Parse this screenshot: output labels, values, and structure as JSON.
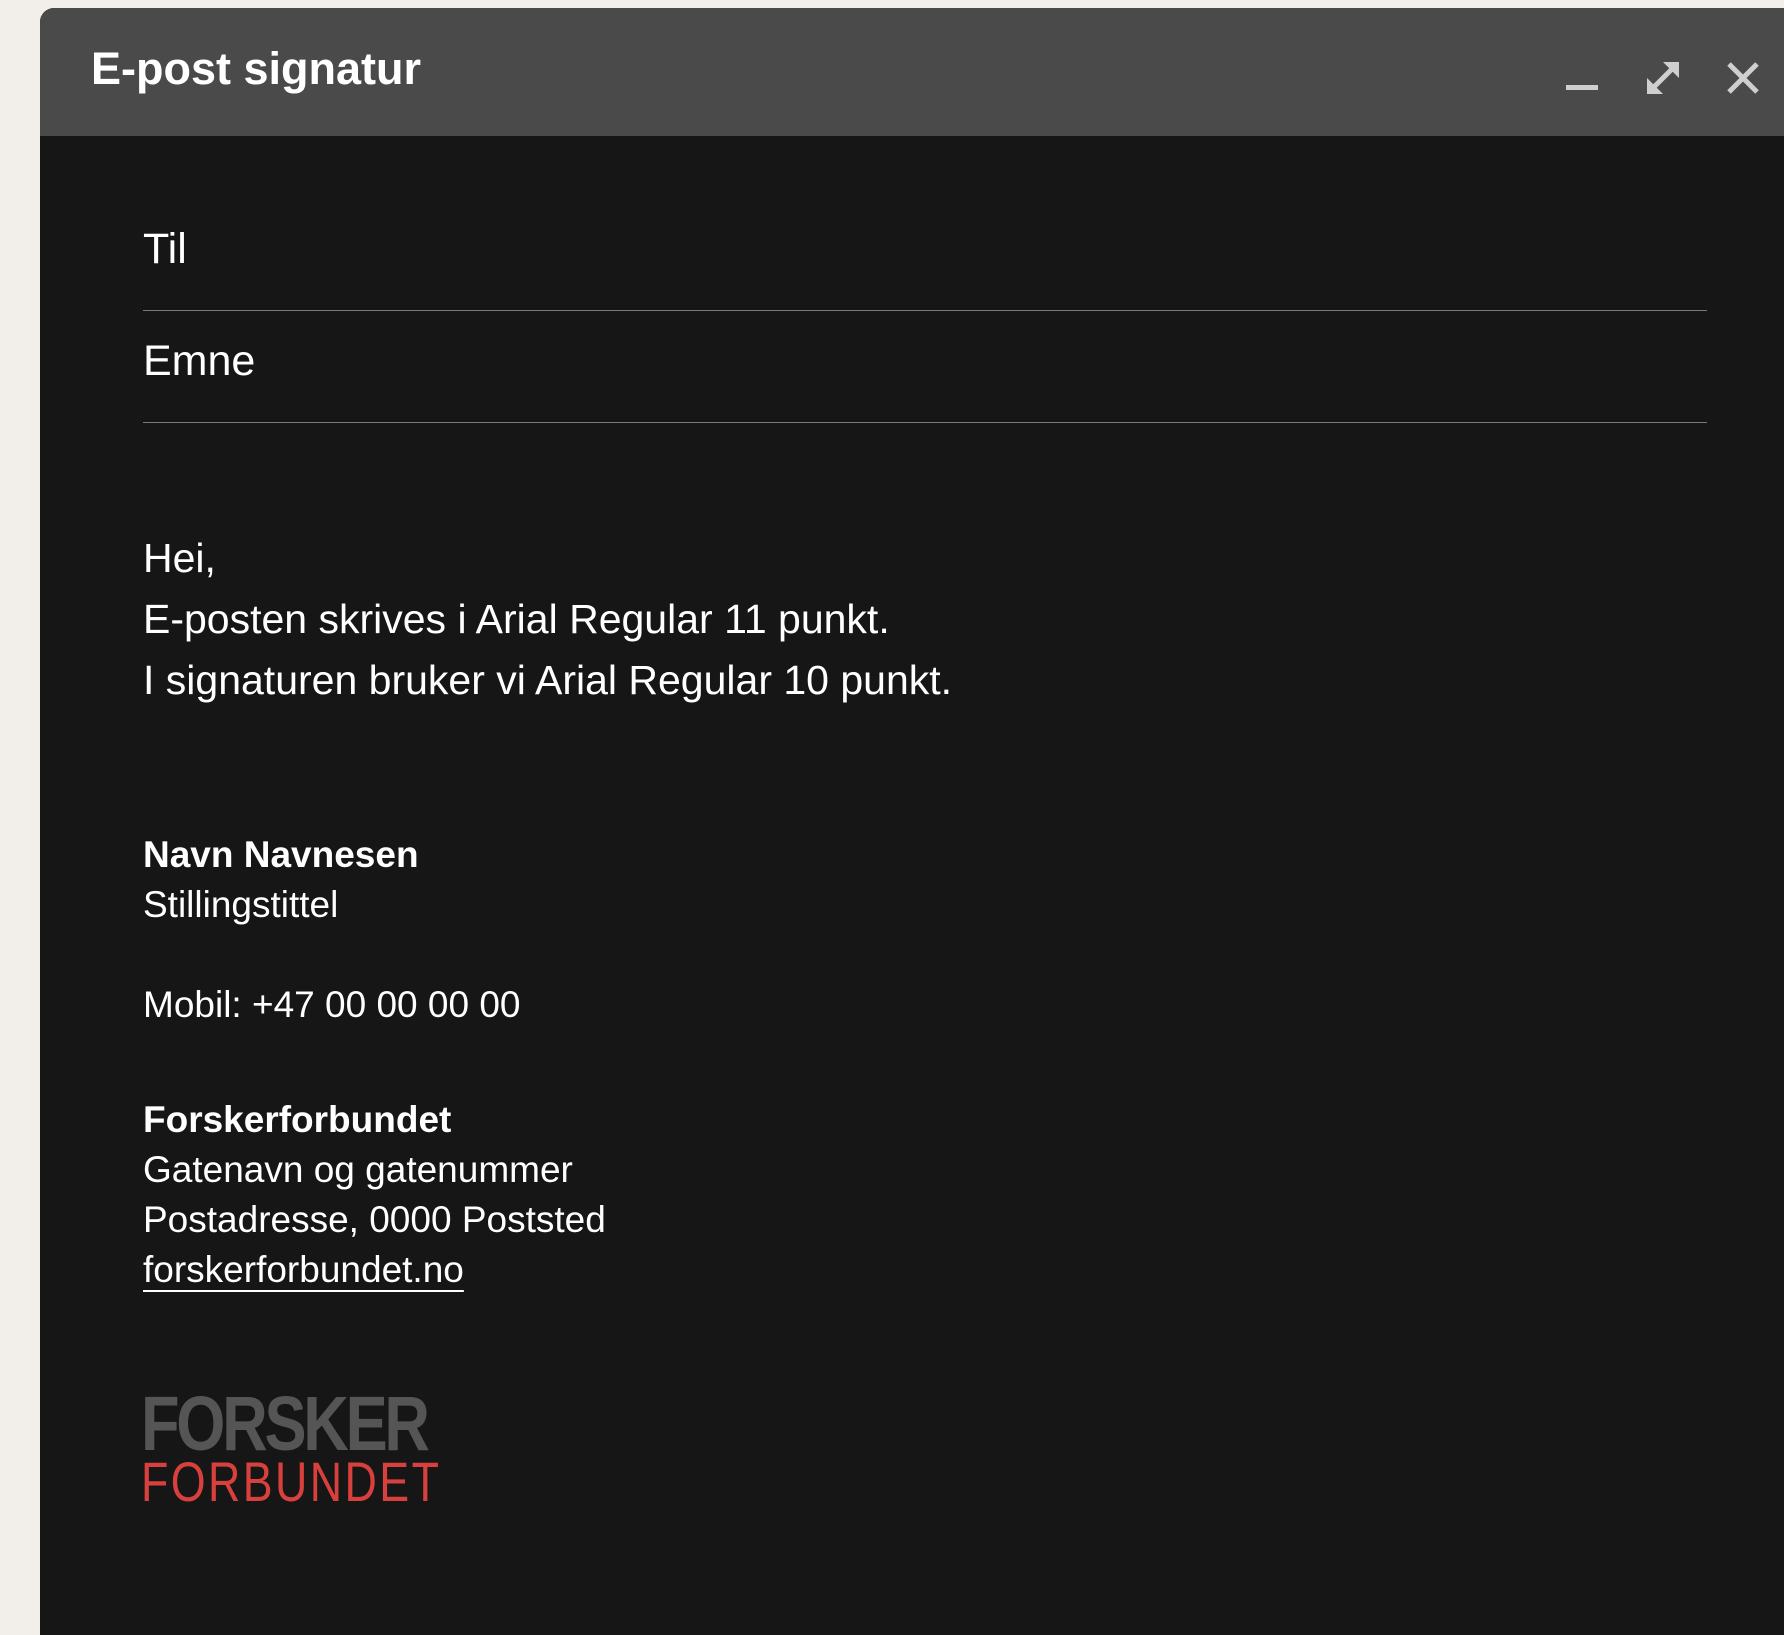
{
  "window": {
    "title": "E-post signatur",
    "controls": {
      "minimize_icon": "minimize-icon",
      "expand_icon": "expand-icon",
      "close_icon": "close-icon"
    }
  },
  "fields": {
    "to_label": "Til",
    "to_value": "",
    "subject_label": "Emne",
    "subject_value": ""
  },
  "body": {
    "lines": [
      "Hei,",
      "E-posten skrives i Arial Regular 11 punkt.",
      "I signaturen bruker vi Arial Regular 10 punkt."
    ]
  },
  "signature": {
    "name": "Navn Navnesen",
    "title": "Stillingstittel",
    "mobile": "Mobil: +47 00 00 00 00",
    "organization": "Forskerforbundet",
    "street": "Gatenavn og gatenummer",
    "postal": "Postadresse, 0000 Poststed",
    "website": "forskerforbundet.no"
  },
  "logo": {
    "top_text": "FORSKER",
    "bottom_text": "FORBUNDET",
    "top_color": "#555555",
    "bottom_color": "#d8403d"
  },
  "colors": {
    "titlebar": "#4a4a4a",
    "background": "#161616",
    "text": "#ffffff"
  }
}
